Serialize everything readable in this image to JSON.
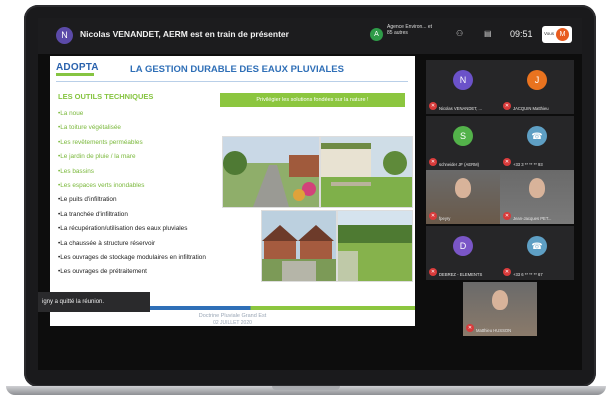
{
  "meeting": {
    "presenter_initial": "N",
    "presenter_text": "Nicolas VENANDET, AERM est en train de présenter",
    "org_initial": "A",
    "org_text": "Agence Environ... et 85 autres",
    "clock": "09:51",
    "user_initial": "M",
    "user_label": "Vous"
  },
  "slide": {
    "logo": "ADOPTA",
    "title": "LA GESTION DURABLE DES EAUX PLUVIALES",
    "section": "LES OUTILS TECHNIQUES",
    "banner": "Privilégier les solutions fondées sur la nature !",
    "tools": [
      {
        "label": "•La noue",
        "tone": "green"
      },
      {
        "label": "•La toiture végétalisée",
        "tone": "green"
      },
      {
        "label": "•Les revêtements perméables",
        "tone": "green"
      },
      {
        "label": "•Le jardin de pluie / la mare",
        "tone": "green"
      },
      {
        "label": "•Les bassins",
        "tone": "green"
      },
      {
        "label": "•Les espaces verts inondables",
        "tone": "green"
      },
      {
        "label": "•Le puits d'infiltration",
        "tone": "dark"
      },
      {
        "label": "•La tranchée d'infiltration",
        "tone": "dark"
      },
      {
        "label": "•La récupération/utilisation des eaux pluviales",
        "tone": "dark"
      },
      {
        "label": "•La chaussée à structure réservoir",
        "tone": "dark"
      },
      {
        "label": "•Les ouvrages de stockage modulaires en infiltration",
        "tone": "dark"
      },
      {
        "label": "•Les ouvrages de prétraitement",
        "tone": "dark"
      }
    ],
    "footer_line1": "Doctrine Pluviale Grand Est",
    "footer_line2": "02 JUILLET 2020"
  },
  "toast": "igny a quitté la réunion.",
  "participants": [
    {
      "initial": "N",
      "name": "Nicolas VENANDET, ...",
      "color": "#6b52c9",
      "video": false
    },
    {
      "initial": "J",
      "name": "JACQUIN Matthieu",
      "color": "#e9731f",
      "video": false
    },
    {
      "initial": "S",
      "name": "schneider JF (AERM)",
      "color": "#53b24a",
      "video": false
    },
    {
      "initial": "☎",
      "name": "+33 3 ** ** ** 93",
      "color": "#5e9fc4",
      "video": false
    },
    {
      "initial": "",
      "name": "fpeyry",
      "color": "#6a5a4a",
      "video": true
    },
    {
      "initial": "",
      "name": "Jean-Jacques PET...",
      "color": "#7a7a7a",
      "video": true
    },
    {
      "initial": "D",
      "name": "DEBREZ - ELEMENTS",
      "color": "#7a56c7",
      "video": false
    },
    {
      "initial": "☎",
      "name": "+33 6 ** ** ** 67",
      "color": "#5e9fc4",
      "video": false
    },
    {
      "initial": "",
      "name": "Matthieu HUSSON",
      "color": "#8a7a6a",
      "video": true
    }
  ],
  "colors": {
    "accent_green": "#86c441",
    "accent_blue": "#2f6fb7",
    "mute_red": "#d83a3a"
  }
}
